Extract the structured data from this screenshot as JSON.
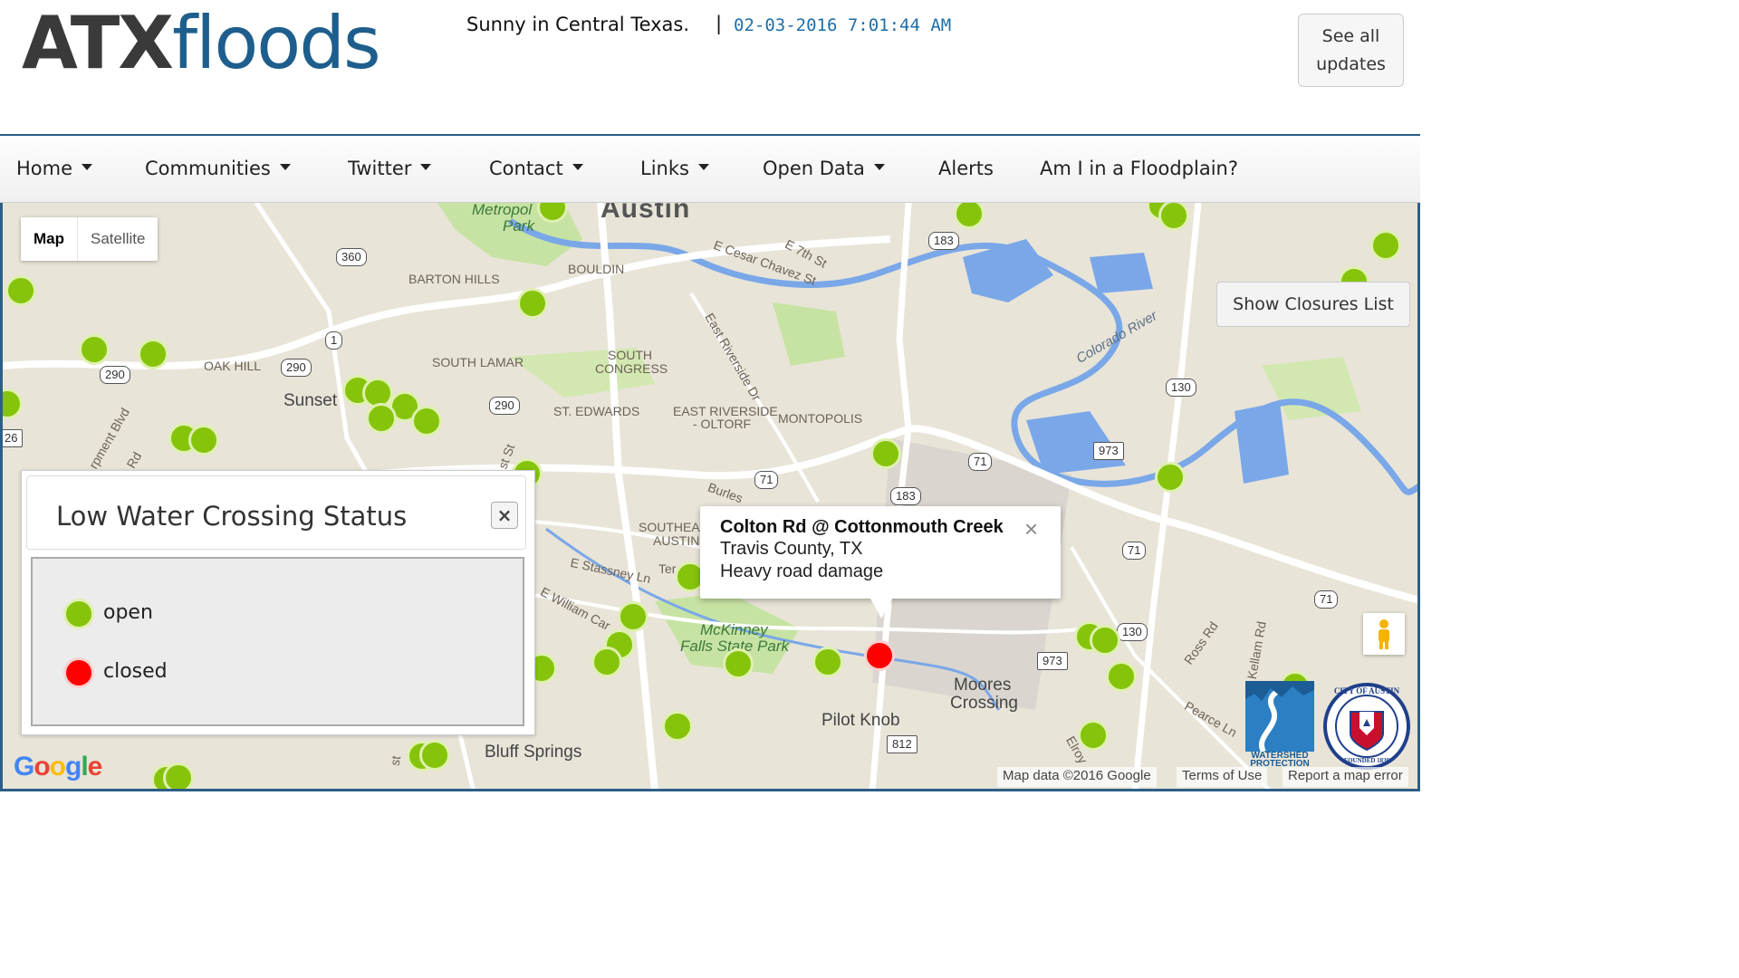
{
  "header": {
    "logo_bold": "ATX",
    "logo_light": "floods",
    "weather": "Sunny in Central Texas.",
    "separator": "|",
    "datetime": "02-03-2016 7:01:44 AM",
    "updates_button_line1": "See all",
    "updates_button_line2": "updates"
  },
  "nav": {
    "items": [
      {
        "label": "Home",
        "dropdown": true
      },
      {
        "label": "Communities",
        "dropdown": true
      },
      {
        "label": "Twitter",
        "dropdown": true
      },
      {
        "label": "Contact",
        "dropdown": true
      },
      {
        "label": "Links",
        "dropdown": true
      },
      {
        "label": "Open Data",
        "dropdown": true
      },
      {
        "label": "Alerts",
        "dropdown": false
      },
      {
        "label": "Am I in a Floodplain?",
        "dropdown": false
      }
    ]
  },
  "map": {
    "type_controls": {
      "map": "Map",
      "satellite": "Satellite"
    },
    "closures_button": "Show Closures List",
    "labels": {
      "austin": "Austin",
      "metropolitan_park_1": "Metropol",
      "metropolitan_park_2": "Park",
      "barton_hills": "BARTON HILLS",
      "bouldin": "BOULDIN",
      "e7th": "E 7th St",
      "cesar": "E Cesar Chavez St",
      "oak_hill": "OAK HILL",
      "south_lamar": "SOUTH LAMAR",
      "south_congress_1": "SOUTH",
      "south_congress_2": "CONGRESS",
      "east_riverside_dr": "East Riverside Dr",
      "colorado_river": "Colorado River",
      "sunset": "Sunset",
      "st_edwards": "ST. EDWARDS",
      "east_riverside_oltorf_1": "EAST RIVERSIDE",
      "east_riverside_oltorf_2": "- OLTORF",
      "montopolis": "MONTOPOLIS",
      "burleson": "Burles",
      "southeast_austin_1": "SOUTHEA",
      "southeast_austin_2": "AUSTIN",
      "e_stassney": "E Stassney Ln",
      "ter": "Ter",
      "e_william_cannon": "E William Car",
      "mckinney_1": "McKinney",
      "mckinney_2": "Falls State Park",
      "moores_1": "Moores",
      "moores_2": "Crossing",
      "pilot_knob": "Pilot Knob",
      "bluff_springs": "Bluff Springs",
      "ross_rd": "Ross Rd",
      "kellam_rd": "Kellam Rd",
      "pearce_ln": "Pearce Ln",
      "elroy": "Elroy",
      "pavement_blvd": "rpment Blvd",
      "st_1": "st St",
      "st_2": "st",
      "rd_1": "Rd"
    },
    "shields": [
      "360",
      "290",
      "1",
      "290",
      "290",
      "183",
      "71",
      "183",
      "130",
      "973",
      "71",
      "71",
      "71",
      "130",
      "973",
      "812",
      "26"
    ],
    "info_window": {
      "title": "Colton Rd @ Cottonmouth Creek",
      "location": "Travis County, TX",
      "status": "Heavy road damage",
      "close": "×"
    },
    "legend": {
      "title": "Low Water Crossing Status",
      "close": "×",
      "items": [
        {
          "label": "open",
          "color": "#86c40c"
        },
        {
          "label": "closed",
          "color": "#ff0000"
        }
      ]
    },
    "attribution": {
      "map_data": "Map data ©2016 Google",
      "terms": "Terms of Use",
      "report": "Report a map error"
    },
    "google_logo": {
      "g": "G",
      "o1": "o",
      "o2": "o",
      "g2": "g",
      "l": "l",
      "e": "e"
    },
    "watershed_text": "WATERSHED PROTECTION",
    "seal_text": "CITY OF AUSTIN",
    "seal_founded": "FOUNDED 1839",
    "colors": {
      "open": "#86c40c",
      "closed": "#ff0000",
      "water": "#7aa7e8",
      "park": "#b8dc8a",
      "nav_border": "#2c5f86"
    }
  }
}
